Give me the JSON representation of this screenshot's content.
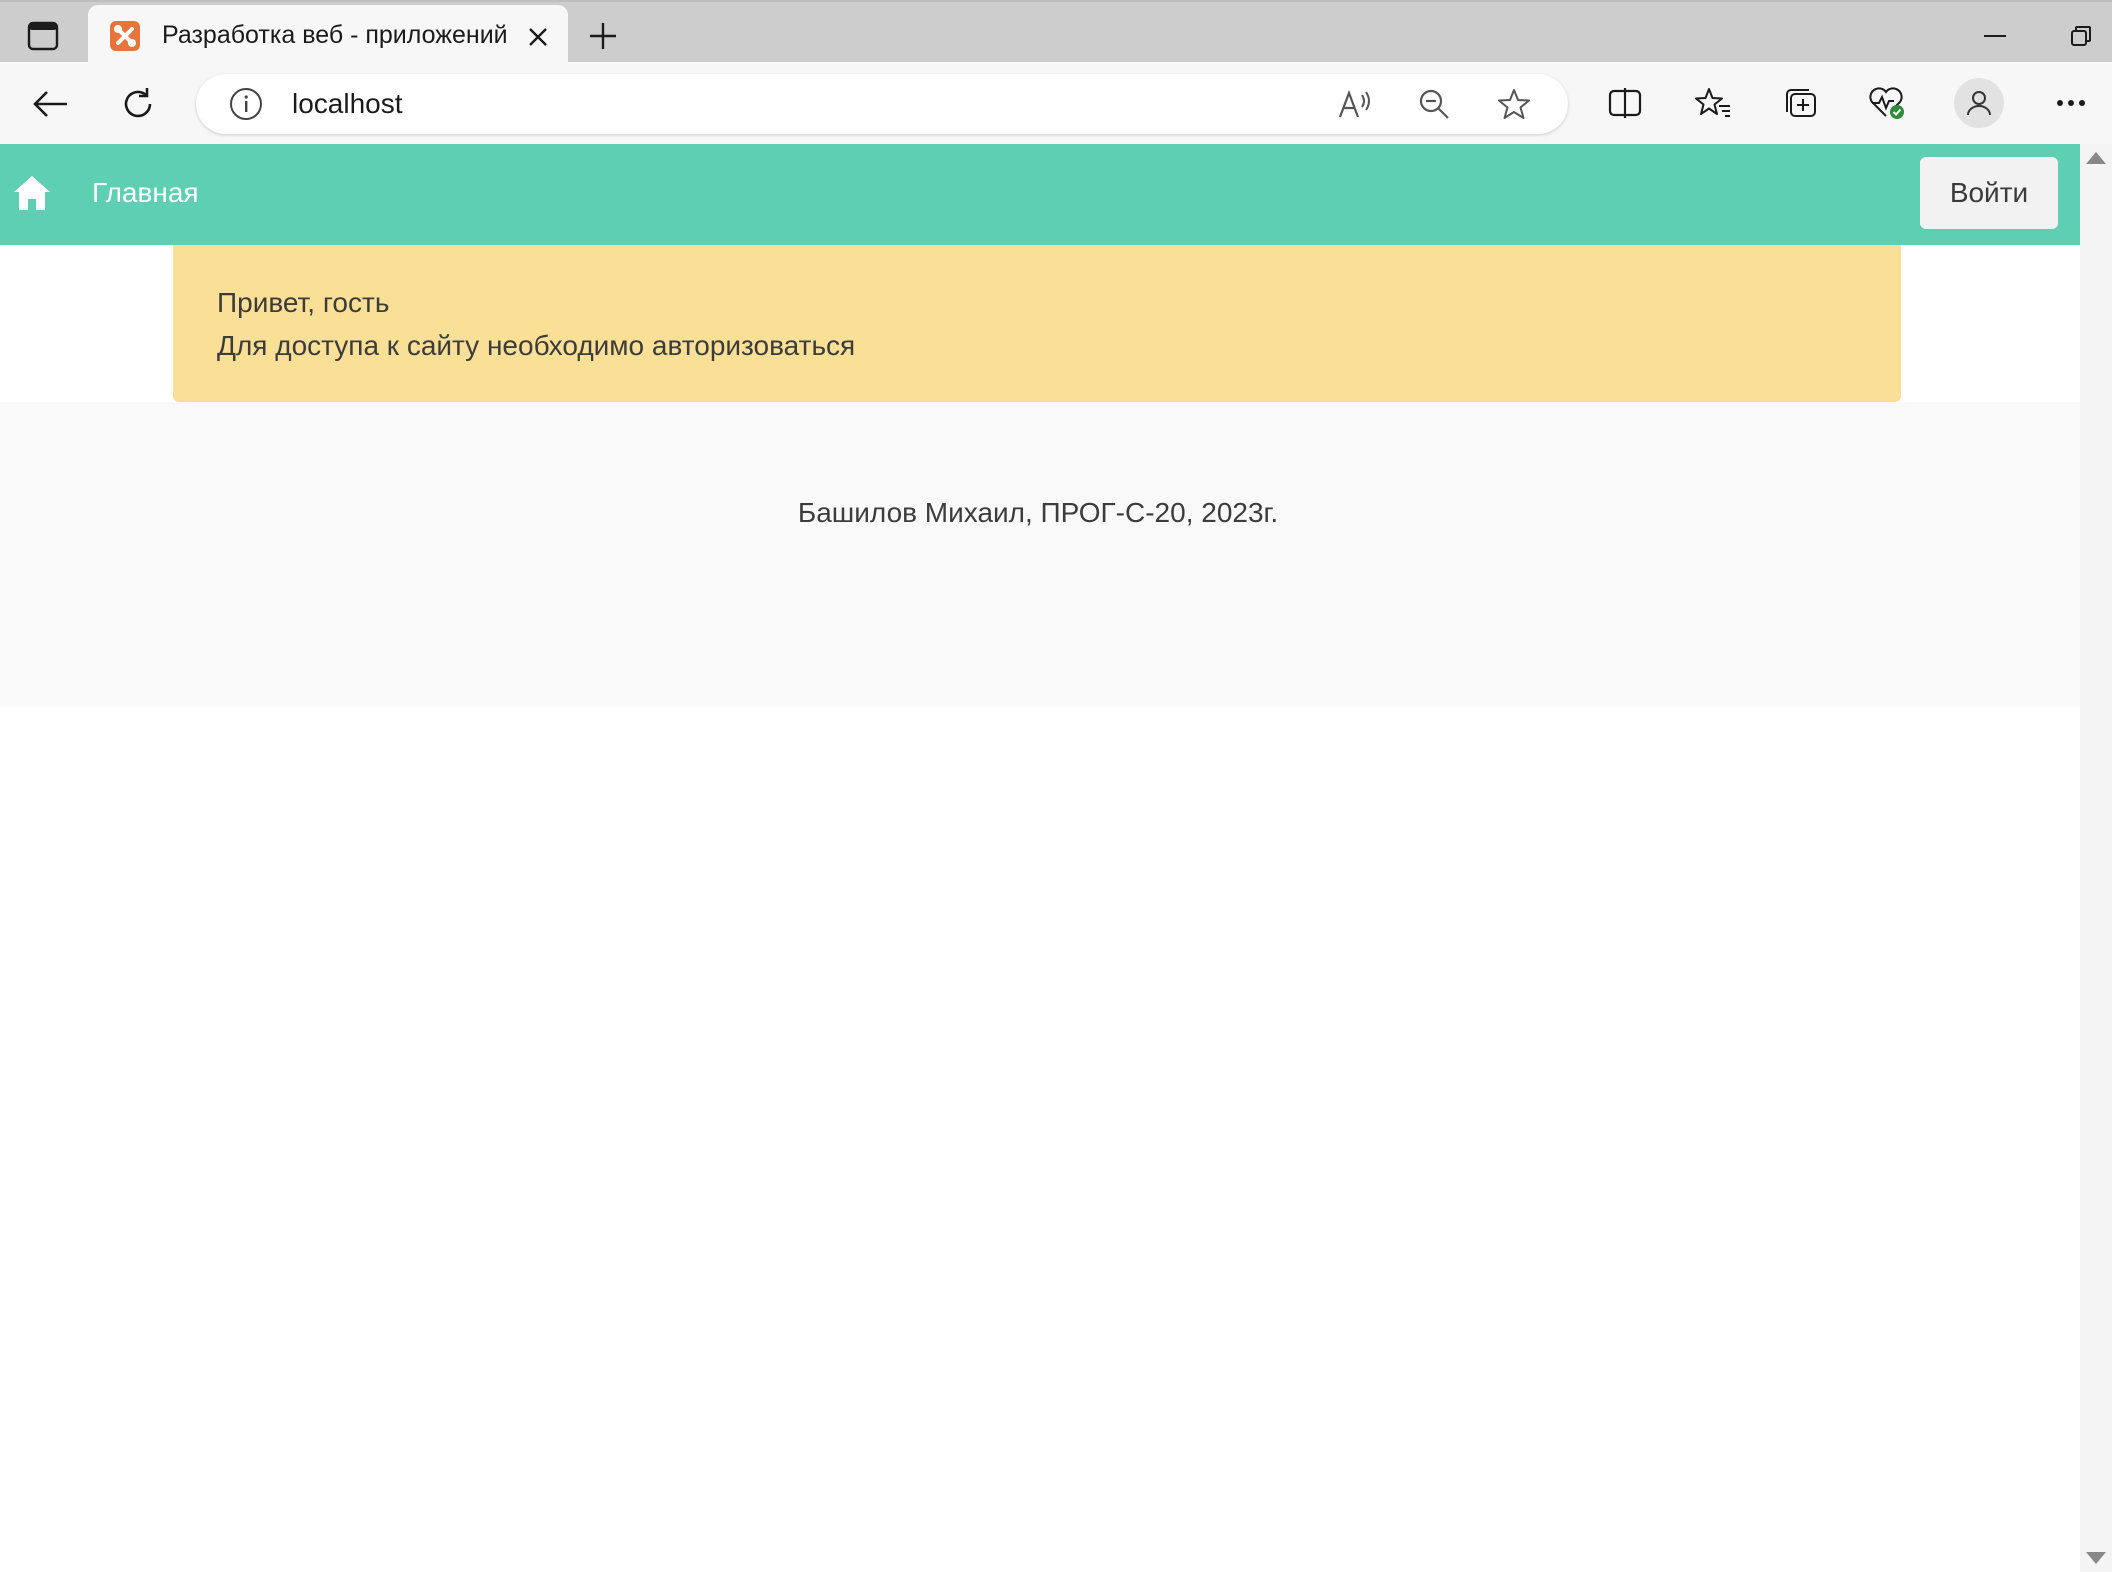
{
  "browser": {
    "tab_title": "Разработка веб - приложений",
    "url": "localhost"
  },
  "site": {
    "nav_home_label": "Главная",
    "login_label": "Войти",
    "header_color": "#5fcfb4"
  },
  "alert": {
    "greeting": "Привет, гость",
    "message": "Для доступа к сайту необходимо авторизоваться",
    "color": "#f9e096"
  },
  "footer": {
    "text": "Башилов Михаил, ПРОГ-С-20, 2023г."
  },
  "icons": [
    "tab-sidebar-icon",
    "xampp-favicon",
    "close-icon",
    "plus-icon",
    "minimize-icon",
    "restore-icon",
    "back-icon",
    "reload-icon",
    "info-icon",
    "read-aloud-icon",
    "zoom-out-icon",
    "star-icon",
    "split-screen-icon",
    "favorites-icon",
    "collections-icon",
    "browser-health-icon",
    "profile-icon",
    "more-icon",
    "home-icon"
  ]
}
